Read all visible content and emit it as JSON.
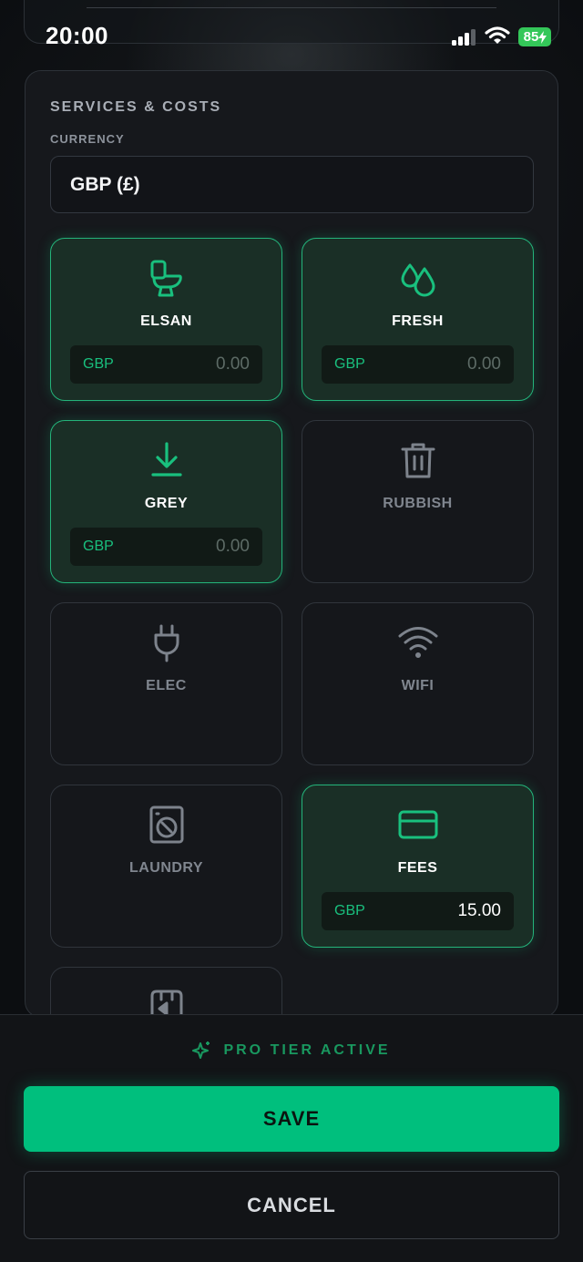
{
  "status_bar": {
    "time": "20:00",
    "battery": "85"
  },
  "section": {
    "title": "SERVICES & COSTS"
  },
  "currency": {
    "label": "CURRENCY",
    "value": "GBP (£)"
  },
  "services": [
    {
      "name": "ELSAN",
      "icon": "toilet-icon",
      "active": true,
      "currency": "GBP",
      "cost": "0.00"
    },
    {
      "name": "FRESH",
      "icon": "water-drops-icon",
      "active": true,
      "currency": "GBP",
      "cost": "0.00"
    },
    {
      "name": "GREY",
      "icon": "download-icon",
      "active": true,
      "currency": "GBP",
      "cost": "0.00"
    },
    {
      "name": "RUBBISH",
      "icon": "trash-icon",
      "active": false
    },
    {
      "name": "ELEC",
      "icon": "plug-icon",
      "active": false
    },
    {
      "name": "WIFI",
      "icon": "wifi-icon",
      "active": false
    },
    {
      "name": "LAUNDRY",
      "icon": "washing-machine-icon",
      "active": false
    },
    {
      "name": "FEES",
      "icon": "credit-card-icon",
      "active": true,
      "currency": "GBP",
      "cost": "15.00"
    },
    {
      "name": "",
      "icon": "gas-bottle-icon",
      "active": false
    }
  ],
  "footer": {
    "pro_label": "PRO TIER ACTIVE",
    "save_label": "SAVE",
    "cancel_label": "CANCEL"
  },
  "colors": {
    "accent": "#00BF7D",
    "active_border": "#24B37A",
    "inactive_icon": "#7D838C"
  }
}
